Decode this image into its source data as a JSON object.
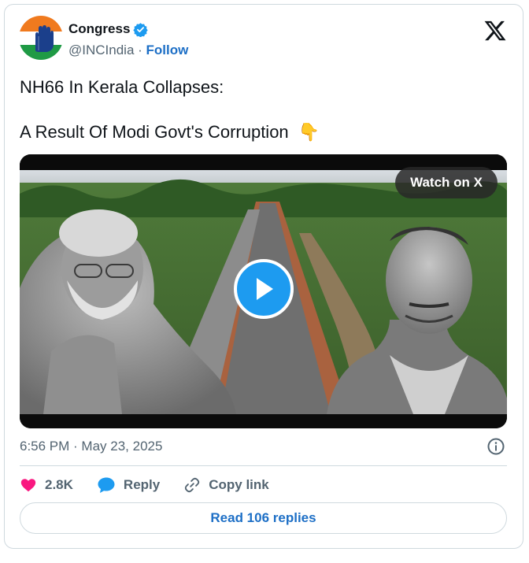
{
  "author": {
    "name": "Congress",
    "handle": "@INCIndia",
    "separator": " · ",
    "follow_label": "Follow"
  },
  "tweet": {
    "line1": "NH66 In Kerala Collapses:",
    "line2": "A Result Of Modi Govt's Corruption",
    "emoji": "👇"
  },
  "media": {
    "watch_label": "Watch on X"
  },
  "meta": {
    "timestamp": "6:56 PM · May 23, 2025"
  },
  "actions": {
    "likes": "2.8K",
    "reply": "Reply",
    "copy": "Copy link"
  },
  "replies": {
    "label": "Read 106 replies"
  },
  "colors": {
    "accent": "#1d9bf0",
    "link": "#1d6fc6",
    "like": "#f91880",
    "border": "#cfd9de",
    "muted": "#536471"
  }
}
